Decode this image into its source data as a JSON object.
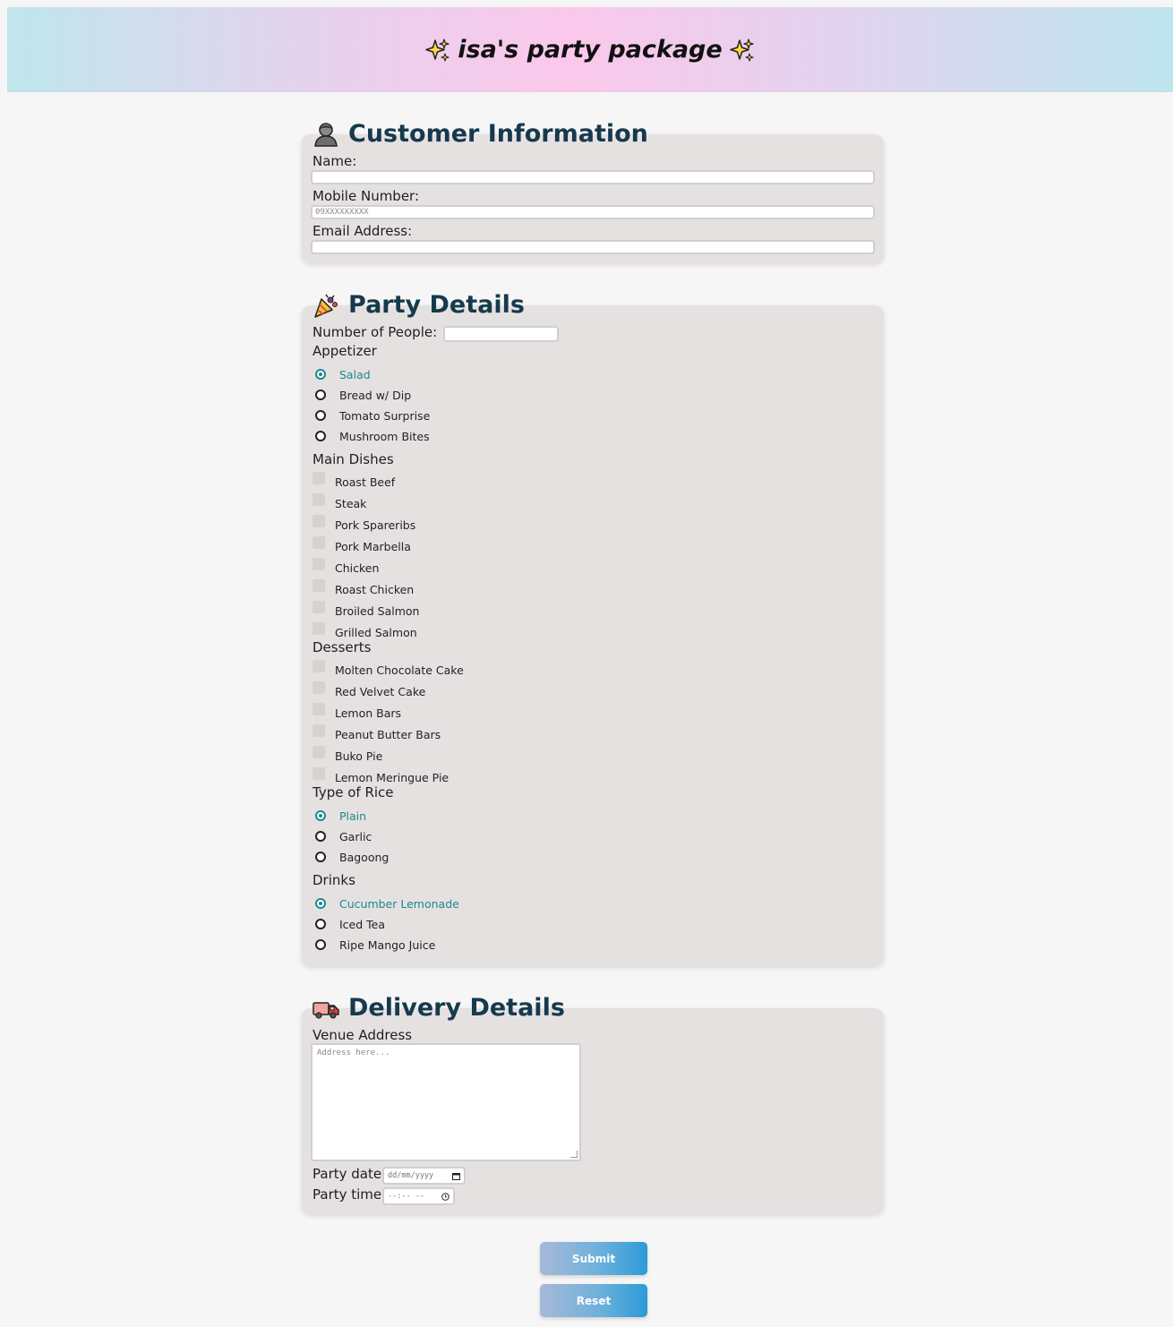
{
  "header": {
    "title": "isa's party package",
    "left_icon": "sparkles-icon",
    "right_icon": "sparkles-icon"
  },
  "customer": {
    "title": "Customer Information",
    "icon": "person-icon",
    "name_label": "Name:",
    "name_value": "",
    "mobile_label": "Mobile Number:",
    "mobile_placeholder": "09XXXXXXXXX",
    "email_label": "Email Address:",
    "email_value": ""
  },
  "party": {
    "title": "Party Details",
    "icon": "party-popper-icon",
    "people_label": "Number of People:",
    "people_value": "",
    "appetizer_label": "Appetizer",
    "appetizers": [
      {
        "label": "Salad",
        "checked": true
      },
      {
        "label": "Bread w/ Dip",
        "checked": false
      },
      {
        "label": "Tomato Surprise",
        "checked": false
      },
      {
        "label": "Mushroom Bites",
        "checked": false
      }
    ],
    "mains_label": "Main Dishes",
    "mains": [
      "Roast Beef",
      "Steak",
      "Pork Spareribs",
      "Pork Marbella",
      "Chicken",
      "Roast Chicken",
      "Broiled Salmon",
      "Grilled Salmon"
    ],
    "desserts_label": "Desserts",
    "desserts": [
      "Molten Chocolate Cake",
      "Red Velvet Cake",
      "Lemon Bars",
      "Peanut Butter Bars",
      "Buko Pie",
      "Lemon Meringue Pie"
    ],
    "rice_label": "Type of Rice",
    "rice": [
      {
        "label": "Plain",
        "checked": true
      },
      {
        "label": "Garlic",
        "checked": false
      },
      {
        "label": "Bagoong",
        "checked": false
      }
    ],
    "drinks_label": "Drinks",
    "drinks": [
      {
        "label": "Cucumber Lemonade",
        "checked": true
      },
      {
        "label": "Iced Tea",
        "checked": false
      },
      {
        "label": "Ripe Mango Juice",
        "checked": false
      }
    ]
  },
  "delivery": {
    "title": "Delivery Details",
    "icon": "delivery-truck-icon",
    "venue_label": "Venue Address",
    "venue_placeholder": "Address here...",
    "date_label": "Party date",
    "date_placeholder": "dd/mm/yyyy",
    "time_label": "Party time",
    "time_placeholder": "--:-- --"
  },
  "buttons": {
    "submit": "Submit",
    "reset": "Reset"
  },
  "colors": {
    "accent": "#1a8a8c",
    "title": "#163a4d",
    "card": "#e6e1e1"
  }
}
